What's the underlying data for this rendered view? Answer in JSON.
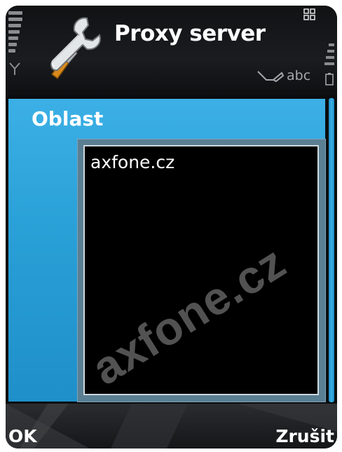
{
  "header": {
    "title": "Proxy server",
    "input_mode": "abc",
    "icons": {
      "app": "wrench-tools-icon",
      "signal": "signal-strength-icon",
      "antenna": "antenna-icon",
      "battery": "battery-icon",
      "menu": "grid-menu-icon",
      "edit": "pen-edit-icon"
    }
  },
  "form": {
    "field_label": "Oblast",
    "field_value": "axfone.cz"
  },
  "softkeys": {
    "left": "OK",
    "right": "Zrušit"
  },
  "watermark": "axfone.cz",
  "colors": {
    "panel": "#2aa1d8",
    "background": "#0c0d0f",
    "text": "#ffffff",
    "input_background": "#000000"
  }
}
